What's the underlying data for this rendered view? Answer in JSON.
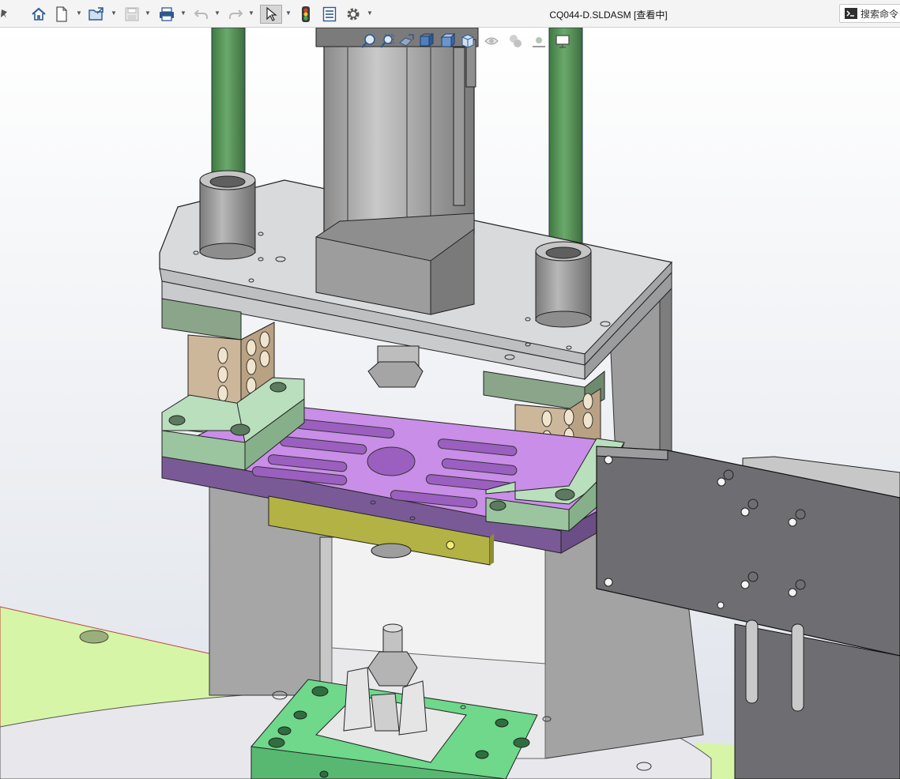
{
  "window": {
    "title": "CQ044-D.SLDASM [查看中]"
  },
  "toolbar": {
    "items": [
      {
        "id": "pin",
        "icon": "pin-icon"
      },
      {
        "id": "home",
        "icon": "home-icon"
      },
      {
        "id": "new",
        "icon": "new-document-icon",
        "dropdown": true
      },
      {
        "id": "open",
        "icon": "open-folder-icon",
        "dropdown": true
      },
      {
        "id": "save",
        "icon": "save-icon",
        "dropdown": true,
        "disabled": true
      },
      {
        "id": "print",
        "icon": "print-icon",
        "dropdown": true
      },
      {
        "id": "undo",
        "icon": "undo-icon",
        "dropdown": true,
        "disabled": true
      },
      {
        "id": "redo",
        "icon": "redo-icon",
        "dropdown": true,
        "disabled": true
      },
      {
        "id": "select",
        "icon": "select-cursor-icon",
        "dropdown": true,
        "active": true
      },
      {
        "id": "rebuild",
        "icon": "traffic-light-icon"
      },
      {
        "id": "file-properties",
        "icon": "file-properties-icon"
      },
      {
        "id": "options",
        "icon": "gear-icon",
        "dropdown": true
      }
    ]
  },
  "search": {
    "label": "搜索命令",
    "icon": "command-prompt-icon"
  },
  "heads_up_toolbar": {
    "items": [
      {
        "id": "zoom-to-fit",
        "icon": "zoom-to-fit-icon"
      },
      {
        "id": "zoom-to-area",
        "icon": "zoom-to-area-icon"
      },
      {
        "id": "previous-view",
        "icon": "previous-view-icon"
      },
      {
        "id": "section-view",
        "icon": "section-view-icon"
      },
      {
        "id": "dynamic-annotation",
        "icon": "dynamic-annotation-icon"
      },
      {
        "id": "view-orientation",
        "icon": "view-orientation-icon",
        "dropdown": true
      },
      {
        "id": "display-style",
        "icon": "display-style-icon",
        "dropdown": true
      },
      {
        "id": "hide-show-items",
        "icon": "eye-icon",
        "dropdown": true
      },
      {
        "id": "edit-appearance",
        "icon": "appearance-icon",
        "dropdown": true
      },
      {
        "id": "apply-scene",
        "icon": "scene-icon",
        "dropdown": true
      },
      {
        "id": "view-settings",
        "icon": "monitor-icon",
        "dropdown": true
      }
    ]
  },
  "colors": {
    "background_top": "#ffffff",
    "background_bottom": "#dfe3ea",
    "guide_rod": "#4c8a4d",
    "base_plate": "#d8dadb",
    "cavity_plate": "#c98ee8",
    "purple_plate": "#7a5a96",
    "light_green_block": "#b9dfbd",
    "gray_green_block": "#8aa58a",
    "beige_block": "#cdb79a",
    "olive_block": "#b3b244",
    "fixture_green": "#6fd88a",
    "floor_green": "#d7f5a6"
  }
}
